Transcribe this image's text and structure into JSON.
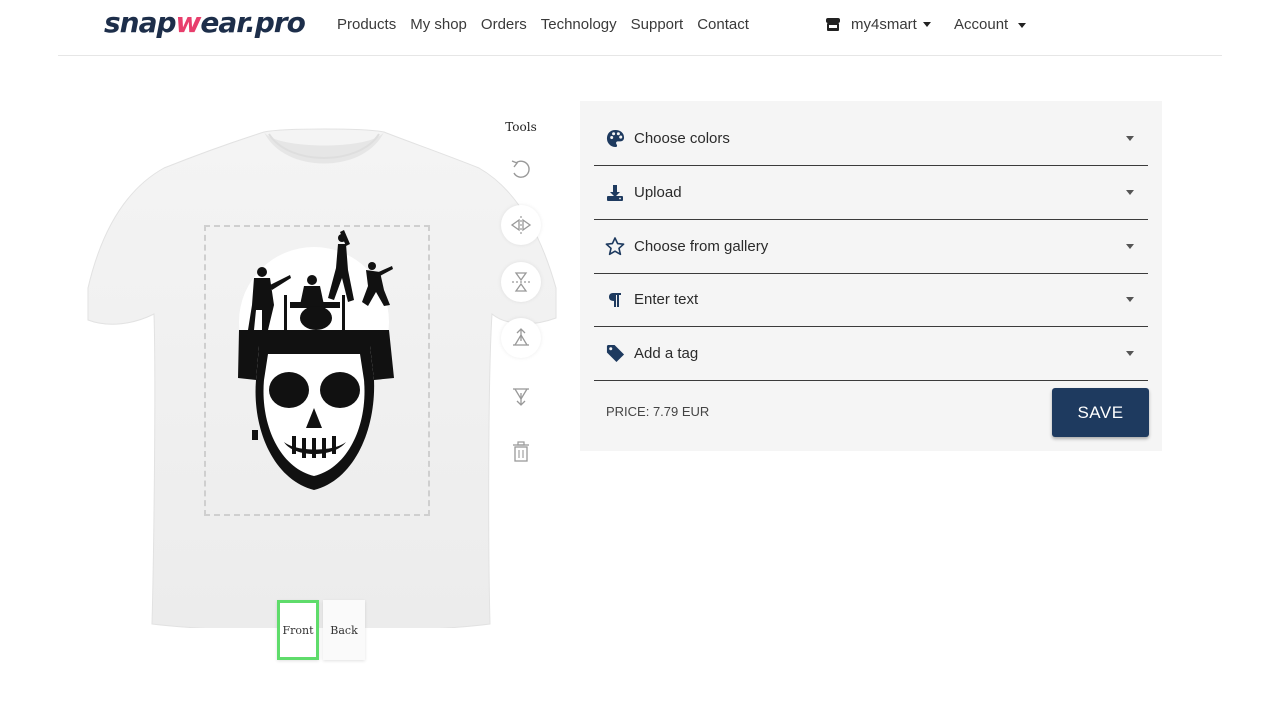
{
  "brand": {
    "part1": "snap",
    "part2": "w",
    "part3": "ear.pro"
  },
  "nav": {
    "links": [
      "Products",
      "My shop",
      "Orders",
      "Technology",
      "Support",
      "Contact"
    ],
    "shop": "my4smart",
    "account": "Account"
  },
  "tools": {
    "label": "Tools",
    "items": [
      "rotate-icon",
      "flip-horizontal-icon",
      "flip-vertical-icon",
      "bring-forward-icon",
      "send-backward-icon",
      "trash-icon"
    ]
  },
  "sides": {
    "front": "Front",
    "back": "Back",
    "active": "Front"
  },
  "options": {
    "colors": "Choose colors",
    "upload": "Upload",
    "gallery": "Choose from gallery",
    "text": "Enter text",
    "tag": "Add a tag"
  },
  "price": "PRICE: 7.79 EUR",
  "save": "SAVE",
  "colors": {
    "accent": "#1e3a5f",
    "active_side": "#5fdc6b",
    "panel_bg": "#f5f5f5",
    "brand_w": "#e83e6c"
  }
}
